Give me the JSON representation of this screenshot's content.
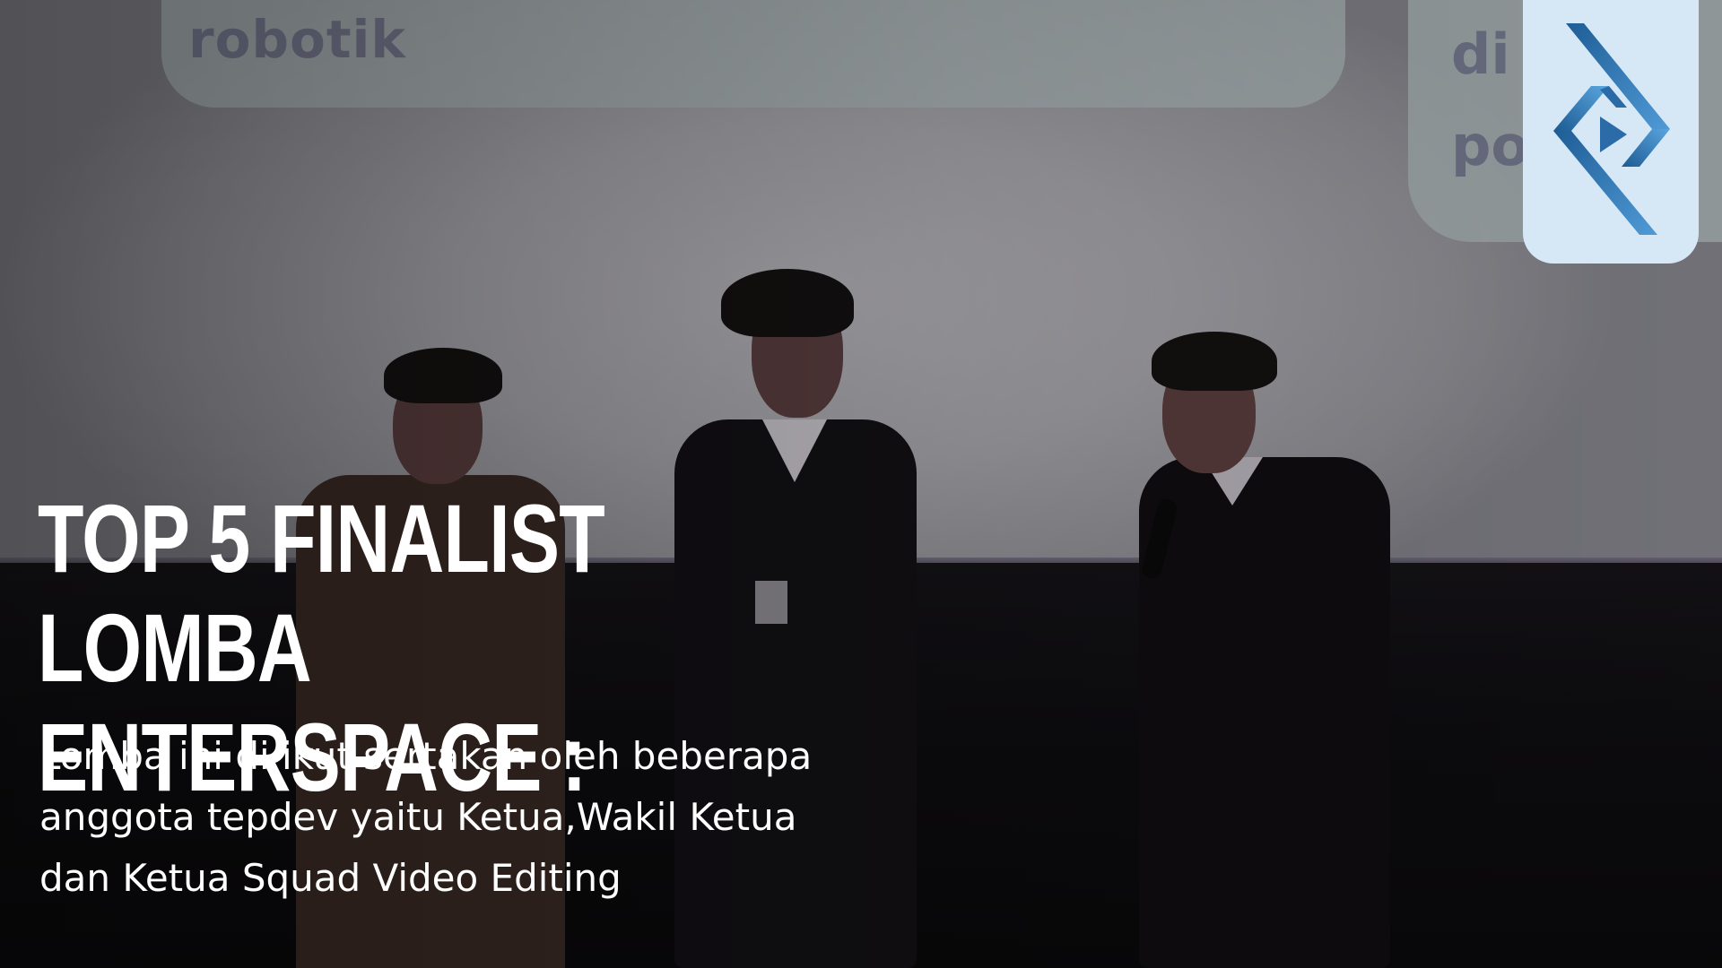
{
  "background_text": {
    "line1": "robotik",
    "right_line1": "di",
    "right_line2": "po"
  },
  "headline": {
    "line1": "TOP 5 FINALIST LOMBA",
    "line2": "ENTERSPACE :"
  },
  "description": {
    "line1": "Lomba ini di ikut sertakan oleh beberapa",
    "line2": "anggota tepdev yaitu Ketua,Wakil Ketua",
    "line3": "dan Ketua Squad Video Editing"
  },
  "logo": {
    "icon": "play-diamond-logo-icon",
    "badge_color": "#d6e8f6",
    "accent_color": "#2f76b5"
  }
}
